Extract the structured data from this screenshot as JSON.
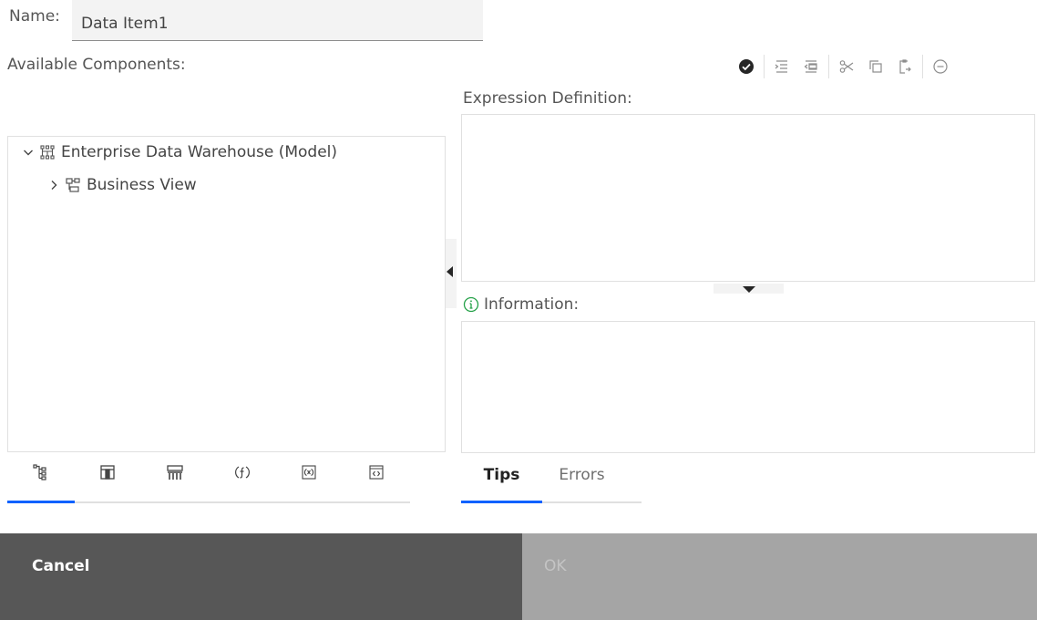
{
  "name_field": {
    "label": "Name:",
    "value": "Data Item1"
  },
  "available_components_label": "Available Components:",
  "expression_definition_label": "Expression Definition:",
  "information_label": "Information:",
  "toolbar": {
    "icons": [
      "validate-check-icon",
      "indent-icon",
      "outdent-icon",
      "cut-icon",
      "copy-icon",
      "paste-icon",
      "remove-icon"
    ]
  },
  "tree": {
    "items": [
      {
        "label": "Enterprise Data Warehouse (Model)",
        "expanded": true,
        "icon": "model-icon"
      },
      {
        "label": "Business View",
        "expanded": false,
        "icon": "namespace-icon"
      }
    ]
  },
  "left_tabs": {
    "items": [
      "source-tree-icon",
      "data-items-icon",
      "query-items-icon",
      "functions-icon",
      "parameters-icon",
      "macros-icon"
    ],
    "active_index": 0
  },
  "info_tabs": {
    "items": [
      {
        "label": "Tips"
      },
      {
        "label": "Errors"
      }
    ],
    "active_index": 0
  },
  "buttons": {
    "cancel": "Cancel",
    "ok": "OK"
  },
  "colors": {
    "accent": "#0f62fe",
    "cancel_bg": "#575757",
    "ok_bg": "#a5a5a5",
    "info_icon": "#24a148"
  }
}
